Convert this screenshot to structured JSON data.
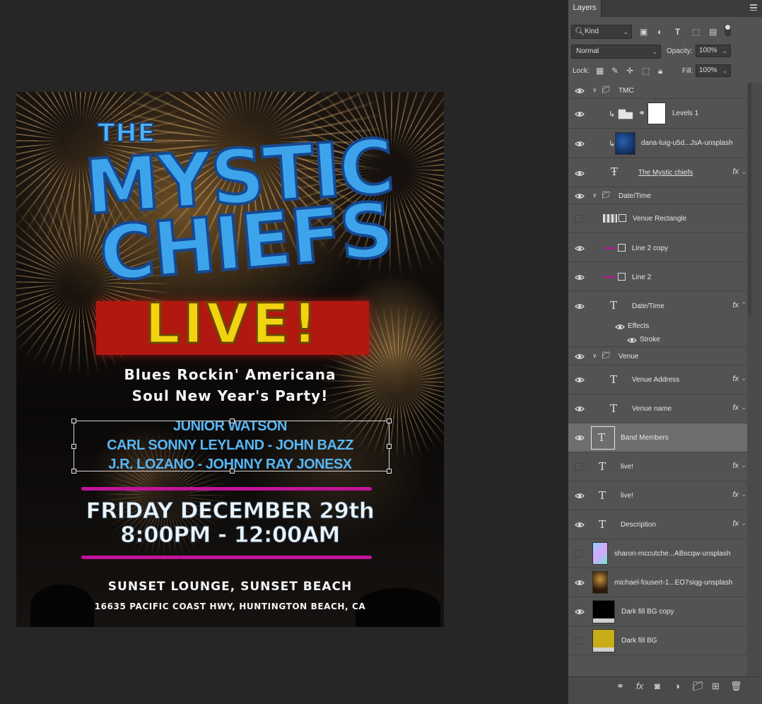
{
  "poster": {
    "the": "THE",
    "title_line1": "MYSTIC",
    "title_line2": "CHIEFS",
    "live": "LIVE!",
    "description_line1": "Blues Rockin' Americana",
    "description_line2": "Soul New Year's Party!",
    "band_line1": "JUNIOR WATSON",
    "band_line2": "CARL SONNY LEYLAND - JOHN BAZZ",
    "band_line3": "J.R. LOZANO - JOHNNY RAY JONESX",
    "date": "FRIDAY DECEMBER 29th",
    "time": "8:00PM - 12:00AM",
    "venue_name": "SUNSET LOUNGE, SUNSET BEACH",
    "venue_address": "16635 PACIFIC COAST HWY, HUNTINGTON BEACH, CA"
  },
  "panel": {
    "tab": "Layers",
    "filter": "Kind",
    "blend_mode": "Normal",
    "opacity_label": "Opacity:",
    "opacity": "100%",
    "lock_label": "Lock:",
    "fill_label": "Fill:",
    "fill": "100%"
  },
  "layers": [
    {
      "name": "TMC",
      "type": "group",
      "visible": true
    },
    {
      "name": "Levels 1",
      "type": "adjustment",
      "visible": true
    },
    {
      "name": "dana-luig-u5d...JsA-unsplash",
      "type": "image",
      "visible": true
    },
    {
      "name": "The Mystic chiefs",
      "type": "warped-text",
      "visible": true,
      "fx": true
    },
    {
      "name": "Date/Time",
      "type": "group",
      "visible": true
    },
    {
      "name": "Venue Rectangle",
      "type": "shape",
      "visible": false
    },
    {
      "name": "Line 2 copy",
      "type": "shape",
      "visible": true
    },
    {
      "name": "Line 2",
      "type": "shape",
      "visible": true
    },
    {
      "name": "Date/Time",
      "type": "text",
      "visible": true,
      "fx": true
    },
    {
      "name": "Effects",
      "type": "effects",
      "visible": true
    },
    {
      "name": "Stroke",
      "type": "effect",
      "visible": true
    },
    {
      "name": "Venue",
      "type": "group",
      "visible": true
    },
    {
      "name": "Venue Address",
      "type": "text",
      "visible": true,
      "fx": true
    },
    {
      "name": "Venue name",
      "type": "text",
      "visible": true,
      "fx": true
    },
    {
      "name": "Band Members",
      "type": "text",
      "visible": true,
      "selected": true
    },
    {
      "name": "live!",
      "type": "text",
      "visible": false,
      "fx": true
    },
    {
      "name": "live!",
      "type": "text",
      "visible": true,
      "fx": true
    },
    {
      "name": "Description",
      "type": "text",
      "visible": true,
      "fx": true
    },
    {
      "name": "sharon-mccutche...ABscqw-unsplash",
      "type": "image",
      "visible": false
    },
    {
      "name": "michael-fousert-1...EO7siqg-unsplash",
      "type": "image",
      "visible": true
    },
    {
      "name": "Dark fill BG copy",
      "type": "fill",
      "visible": true
    },
    {
      "name": "Dark fill BG",
      "type": "fill",
      "visible": false
    }
  ],
  "footer_icons": [
    "link-icon",
    "fx-icon",
    "mask-icon",
    "adjustment-icon",
    "folder-icon",
    "new-layer-icon",
    "trash-icon"
  ],
  "fx_symbol": "fx",
  "colors": {
    "accent_blue": "#3da4ec",
    "live_yellow": "#f2d312",
    "live_red": "#b11810",
    "line_magenta": "#c2149a"
  }
}
